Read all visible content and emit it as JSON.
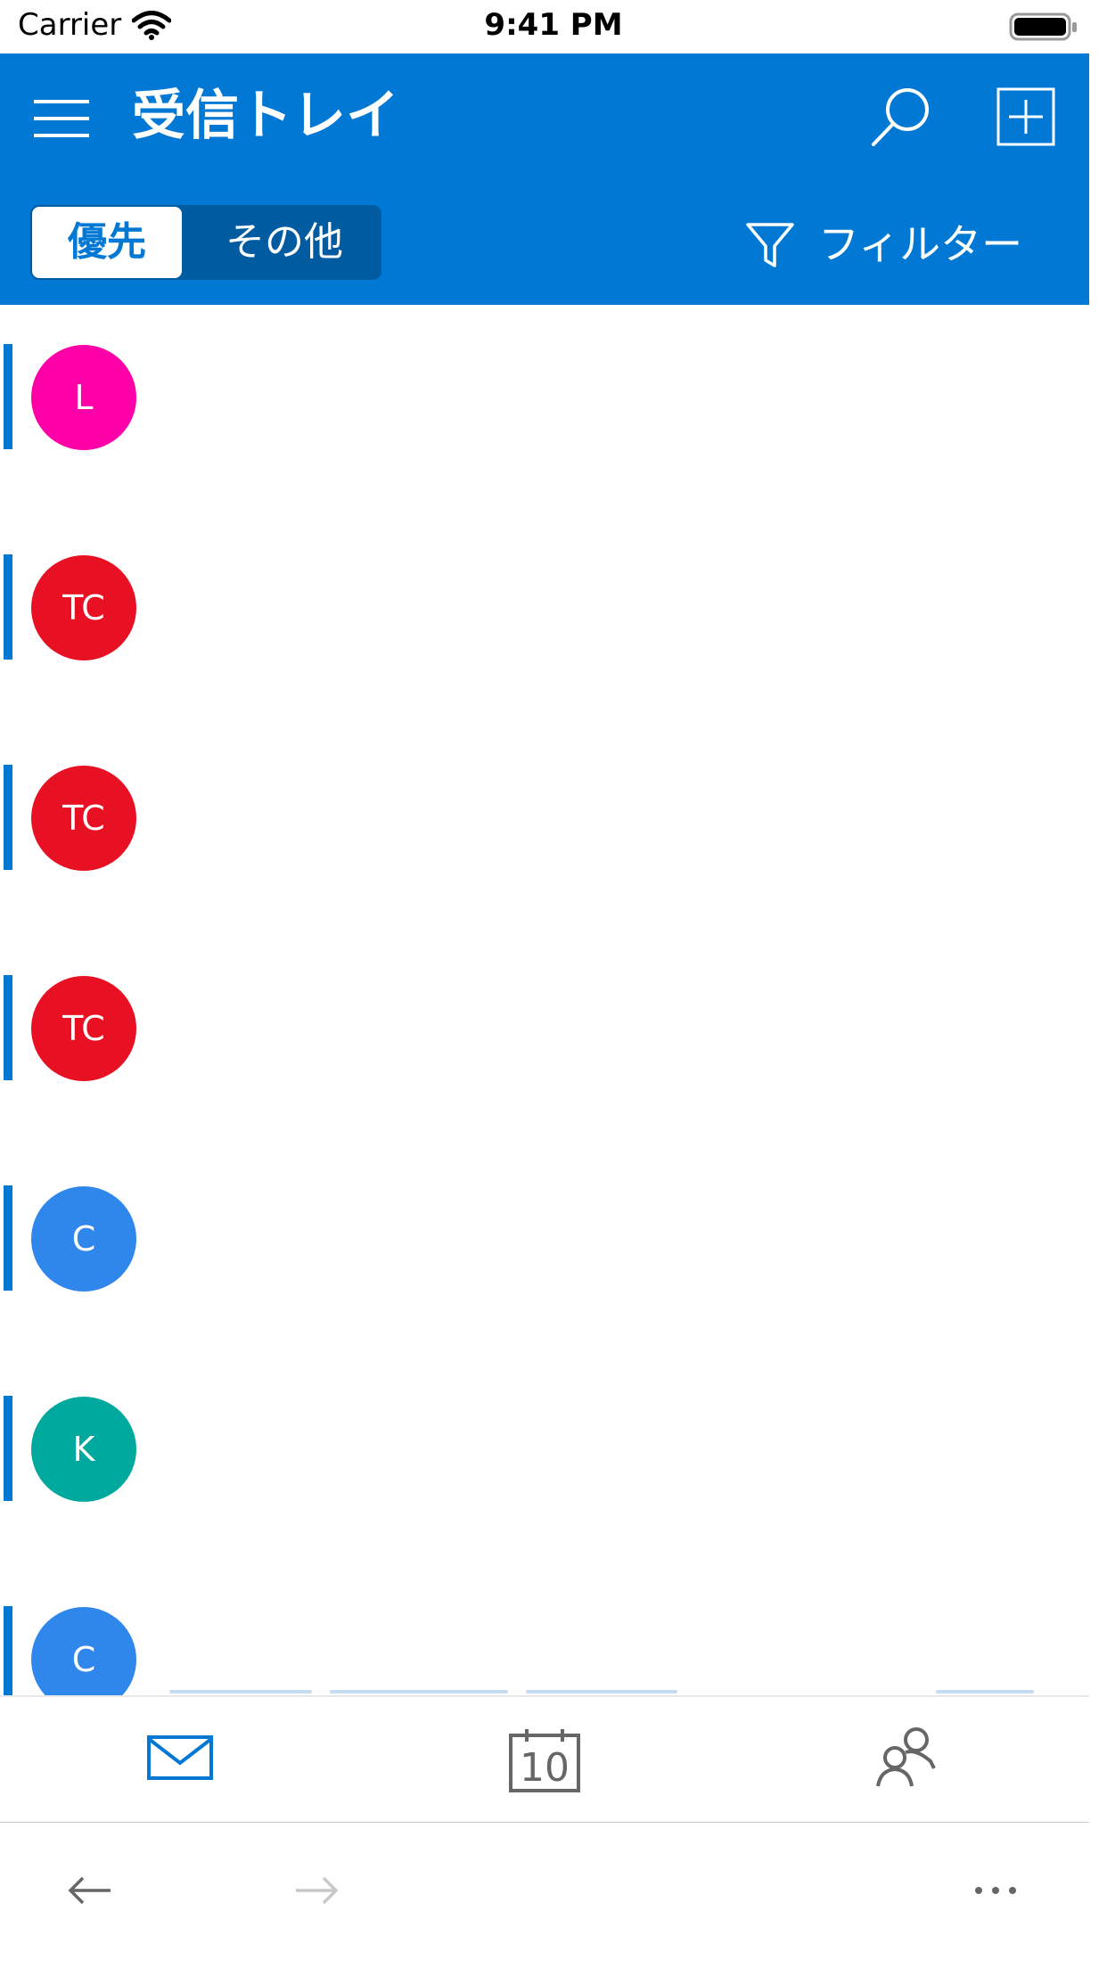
{
  "status_bar": {
    "carrier": "Carrier",
    "time": "9:41 PM"
  },
  "header": {
    "title": "受信トレイ",
    "icons": {
      "menu": "hamburger-menu-icon",
      "search": "search-icon",
      "compose": "compose-plus-icon"
    },
    "inbox_switch": {
      "focused": "優先",
      "other": "その他",
      "selected": "優先"
    },
    "filter": {
      "label": "フィルター",
      "icon": "funnel-icon"
    }
  },
  "messages": [
    {
      "initials": "L",
      "color": "#ff00a8",
      "unread": true
    },
    {
      "initials": "TC",
      "color": "#e81123",
      "unread": true
    },
    {
      "initials": "TC",
      "color": "#e81123",
      "unread": true
    },
    {
      "initials": "TC",
      "color": "#e81123",
      "unread": true
    },
    {
      "initials": "C",
      "color": "#2f87ec",
      "unread": true
    },
    {
      "initials": "K",
      "color": "#00a99d",
      "unread": true
    },
    {
      "initials": "C",
      "color": "#2f87ec",
      "unread": true
    }
  ],
  "tab_bar": {
    "tabs": [
      {
        "name": "mail",
        "icon": "mail-envelope-icon",
        "active": true
      },
      {
        "name": "calendar",
        "icon": "calendar-icon",
        "day": "10",
        "active": false
      },
      {
        "name": "people",
        "icon": "people-icon",
        "active": false
      }
    ]
  },
  "browser_toolbar": {
    "back": "back-arrow-icon",
    "forward": "forward-arrow-icon",
    "more": "more-dots-icon"
  },
  "colors": {
    "accent": "#0078d4",
    "segment_bg": "#005ba1",
    "icon_gray": "#666666"
  }
}
